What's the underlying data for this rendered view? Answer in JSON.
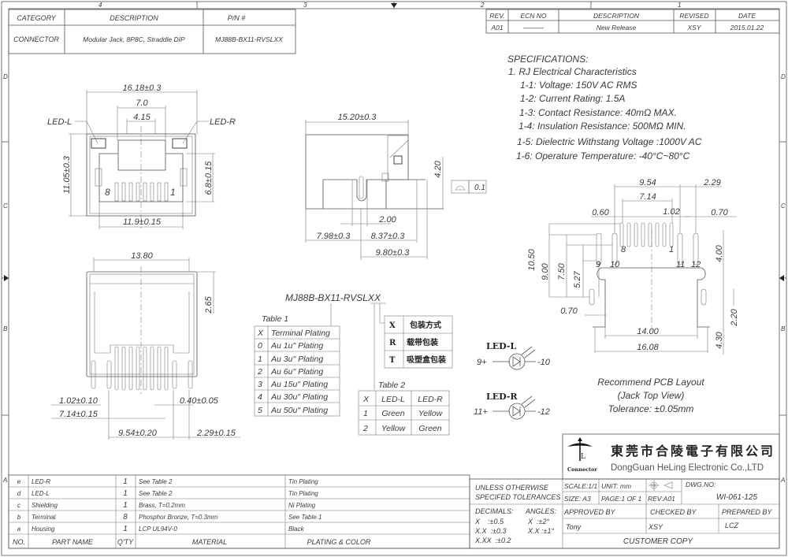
{
  "border": {
    "top_zones": [
      "4",
      "3",
      "2",
      "1"
    ],
    "side_zones": [
      "D",
      "C",
      "B",
      "A"
    ]
  },
  "header_table": {
    "headers": [
      "CATEGORY",
      "DESCRIPTION",
      "P/N #"
    ],
    "values": [
      "CONNECTOR",
      "Modular Jack, 8P8C, Straddle DIP",
      "MJ88B-BX11-RVSLXX"
    ]
  },
  "revision_table": {
    "headers": [
      "REV.",
      "ECN NO",
      "DESCRIPTION",
      "REVISED",
      "DATE"
    ],
    "values": [
      "A01",
      "———",
      "New Release",
      "XSY",
      "2015.01.22"
    ]
  },
  "specifications": {
    "title": "SPECIFICATIONS:",
    "section": "1. RJ Electrical Characteristics",
    "items": [
      "1-1: Voltage: 150V AC RMS",
      "1-2: Current Rating: 1.5A",
      "1-3: Contact Resistance: 40mΩ MAX.",
      "1-4: Insulation Resistance: 500MΩ MIN.",
      "1-5: Dielectric Withstang Voltage :1000V AC",
      "1-6: Operature Temperature: -40°C~80°C"
    ]
  },
  "front_view": {
    "dims": {
      "width": "16.18±0.3",
      "opening": "7.0",
      "tab": "4.15",
      "height": "11.05±0.3",
      "opening_h": "6.8±0.15",
      "bottom": "11.9±0.15"
    },
    "labels": {
      "led_l": "LED-L",
      "led_r": "LED-R",
      "pin8": "8",
      "pin1": "1"
    }
  },
  "side_view": {
    "dims": {
      "length": "15.20±0.3",
      "height": "4.20",
      "pin_w": "2.00",
      "d1": "7.98±0.3",
      "d2": "8.37±0.3",
      "d3": "9.80±0.3",
      "flatness": "0.1"
    }
  },
  "rear_view": {
    "dims": {
      "width": "13.80",
      "height": "2.65",
      "pitch": "1.02±0.10",
      "pin_w": "0.40±0.05",
      "span": "7.14±0.15",
      "led_span": "9.54±0.20",
      "led_pitch": "2.29±0.15"
    }
  },
  "pcb_layout": {
    "dims": {
      "d954": "9.54",
      "d229": "2.29",
      "d714": "7.14",
      "d060": "0.60",
      "d102": "1.02",
      "d070a": "0.70",
      "d1050": "10.50",
      "d900": "9.00",
      "d750": "7.50",
      "d527": "5.27",
      "d400": "4.00",
      "d070b": "0.70",
      "d220": "2.20",
      "d430": "4.30",
      "d1400": "14.00",
      "d1608": "16.08"
    },
    "pins": [
      "8",
      "1",
      "9",
      "10",
      "11",
      "12"
    ],
    "caption": [
      "Recommend PCB Layout",
      "(Jack Top View)",
      "Tolerance: ±0.05mm"
    ]
  },
  "part_code": {
    "code": "MJ88B-BX11-RVSLXX",
    "table1": {
      "title": "Table 1",
      "headers": [
        "X",
        "Terminal Plating"
      ],
      "rows": [
        [
          "0",
          "Au 1u\" Plating"
        ],
        [
          "1",
          "Au 3u\" Plating"
        ],
        [
          "2",
          "Au 6u\" Plating"
        ],
        [
          "3",
          "Au 15u\" Plating"
        ],
        [
          "4",
          "Au 30u\" Plating"
        ],
        [
          "5",
          "Au 50u\" Plating"
        ]
      ]
    },
    "table2": {
      "title": "Table 2",
      "headers": [
        "X",
        "LED-L",
        "LED-R"
      ],
      "rows": [
        [
          "1",
          "Green",
          "Yellow"
        ],
        [
          "2",
          "Yellow",
          "Green"
        ]
      ]
    },
    "packing": {
      "headers": [
        "X",
        "包装方式"
      ],
      "rows": [
        [
          "R",
          "载带包装"
        ],
        [
          "T",
          "吸塑盒包装"
        ]
      ]
    }
  },
  "leds": [
    {
      "name": "LED-L",
      "plus": "9+",
      "minus": "-10"
    },
    {
      "name": "LED-R",
      "plus": "11+",
      "minus": "-12"
    }
  ],
  "bom": {
    "headers": [
      "NO.",
      "PART NAME",
      "Q'TY",
      "MATERIAL",
      "PLATING & COLOR"
    ],
    "rows": [
      [
        "e",
        "LED-R",
        "1",
        "See Table 2",
        "Tin Plating"
      ],
      [
        "d",
        "LED-L",
        "1",
        "See Table 2",
        "Tin Plating"
      ],
      [
        "c",
        "Shielding",
        "1",
        "Brass, T=0.2mm",
        "Ni Plating"
      ],
      [
        "b",
        "Terminal",
        "8",
        "Phosphor Bronze, T=0.3mm",
        "See Table 1"
      ],
      [
        "a",
        "Housing",
        "1",
        "LCP UL94V-0",
        "Black"
      ]
    ]
  },
  "title_block": {
    "company_cn": "東莞市合陵電子有限公司",
    "company_en": "DongGuan HeLing Electronic Co.,LTD",
    "logo_text": "Connector",
    "tolerance_title": [
      "UNLESS OTHERWISE",
      "SPECIFED TOLERANCES"
    ],
    "tolerances": {
      "decimals": "DECIMALS:",
      "angles": "ANGLES:",
      "x": "X    :±0.5",
      "xx": "X.X  :±0.3",
      "xxx": "X.XX  :±0.2",
      "ax": "X  :±2°",
      "axx": "X.X :±1°"
    },
    "scale": "SCALE:1/1",
    "unit": "UNIT: mm",
    "size": "SIZE: A3",
    "page": "PAGE:1 OF 1",
    "rev": "REV:A01",
    "dwg_label": "DWG.NO:",
    "dwg_no": "WI-061-125",
    "approved_label": "APPROVED BY",
    "checked_label": "CHECKED BY",
    "prepared_label": "PREPARED BY",
    "approved": "Tony",
    "checked": "XSY",
    "prepared": "LCZ",
    "copy": "CUSTOMER COPY"
  }
}
